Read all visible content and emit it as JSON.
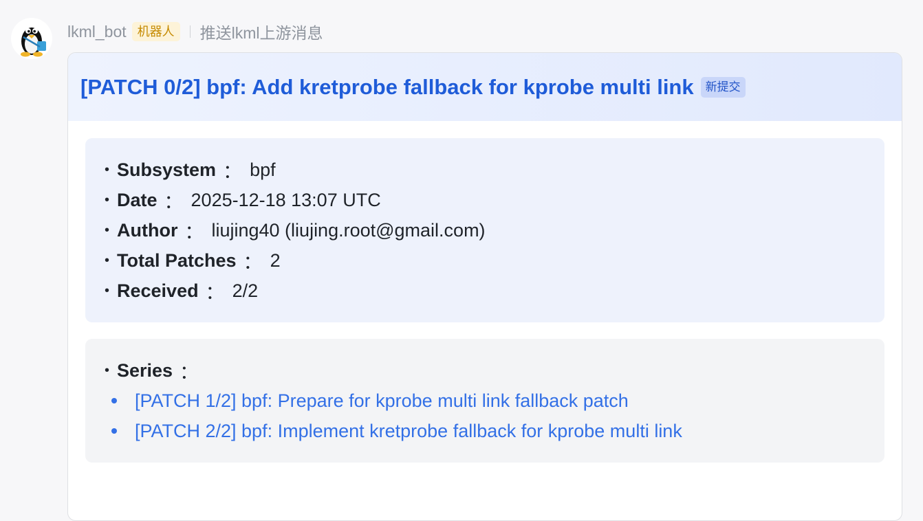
{
  "sender": {
    "name": "lkml_bot",
    "badge": "机器人",
    "subtitle": "推送lkml上游消息"
  },
  "card": {
    "title": "[PATCH 0/2] bpf: Add kretprobe fallback for kprobe multi link",
    "tag": "新提交",
    "fields": [
      {
        "key": "Subsystem",
        "sep": "：",
        "value": "bpf"
      },
      {
        "key": "Date",
        "sep": "：",
        "value": "2025-12-18 13:07 UTC"
      },
      {
        "key": "Author",
        "sep": "：",
        "value": "liujing40 (liujing.root@gmail.com)"
      },
      {
        "key": "Total Patches",
        "sep": "：",
        "value": "2"
      },
      {
        "key": "Received",
        "sep": "：",
        "value": "2/2"
      }
    ],
    "series": {
      "key": "Series",
      "sep": "：",
      "items": [
        "[PATCH 1/2] bpf: Prepare for kprobe multi link fallback patch",
        "[PATCH 2/2] bpf: Implement kretprobe fallback for kprobe multi link"
      ]
    }
  },
  "colors": {
    "link": "#3370e6",
    "title": "#1f5cd8",
    "badge_bg": "#fdf3d8",
    "badge_fg": "#c58a00"
  },
  "icons": {
    "avatar": "tux-penguin-icon"
  }
}
